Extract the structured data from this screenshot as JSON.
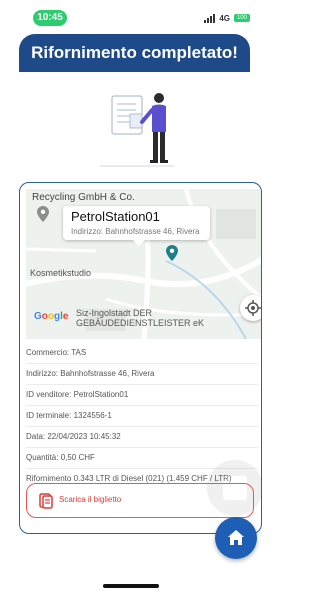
{
  "status_bar": {
    "time": "10:45",
    "network": "4G",
    "battery": "100"
  },
  "header": {
    "title": "Rifornimento completato!"
  },
  "map": {
    "label_top": "Recycling GmbH & Co.",
    "label_mid": "Kosmetikstudio",
    "callout_title": "PetrolStation01",
    "callout_address": "Indirizzo: Bahnhofstrasse 46, Rivera",
    "bottom_text_1": "Siz-Ingolstadt DER",
    "bottom_text_2": "GEBÄUDEDIENSTLEISTER eK",
    "google_logo": [
      "G",
      "o",
      "o",
      "g",
      "l",
      "e"
    ]
  },
  "details": {
    "commercio": "Commercio: TAS",
    "indirizzo": "Indirizzo: Bahnhofstrasse 46, Rivera",
    "id_venditore": "ID venditore: PetrolStation01",
    "id_terminale": "ID terminale: 1324556-1",
    "data": "Data: 22/04/2023 10:45:32",
    "quantita": "Quantità: 0,50 CHF",
    "rifornimento": "Rifornimento 0.343 LTR di Diesel (021) (1.459 CHF / LTR)"
  },
  "actions": {
    "download_label": "Scarica il biglietto"
  },
  "colors": {
    "primary": "#1e4a8a",
    "accent_red": "#e03a3a",
    "status_green": "#2ecc71"
  },
  "icons": {
    "map_pin_gray": "map-pin-icon",
    "map_pin_teal": "station-pin-icon",
    "locate": "locate-icon",
    "download": "ticket-icon",
    "home": "home-icon"
  }
}
